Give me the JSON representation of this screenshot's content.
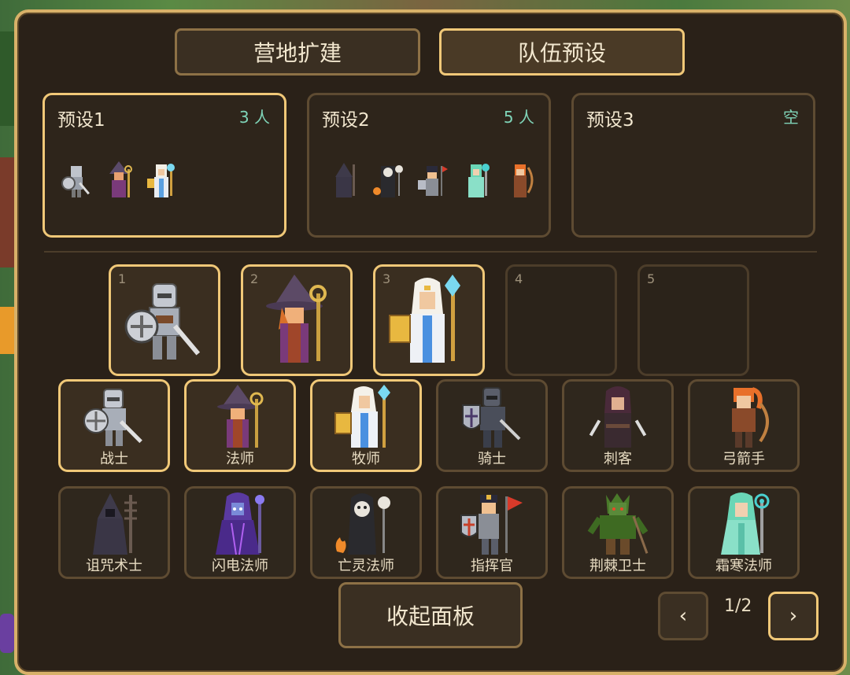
{
  "tabs": [
    {
      "label": "营地扩建",
      "active": false
    },
    {
      "label": "队伍预设",
      "active": true
    }
  ],
  "presets": [
    {
      "name": "预设1",
      "count": "3 人",
      "active": true
    },
    {
      "name": "预设2",
      "count": "5 人",
      "active": false
    },
    {
      "name": "预设3",
      "count": "空",
      "active": false
    }
  ],
  "slots": [
    {
      "number": "1",
      "unit": "warrior"
    },
    {
      "number": "2",
      "unit": "mage"
    },
    {
      "number": "3",
      "unit": "priest"
    },
    {
      "number": "4",
      "unit": ""
    },
    {
      "number": "5",
      "unit": ""
    }
  ],
  "roster": [
    {
      "label": "战士",
      "unit": "warrior",
      "selected": true
    },
    {
      "label": "法师",
      "unit": "mage",
      "selected": true
    },
    {
      "label": "牧师",
      "unit": "priest",
      "selected": true
    },
    {
      "label": "骑士",
      "unit": "knight",
      "selected": false
    },
    {
      "label": "刺客",
      "unit": "assassin",
      "selected": false
    },
    {
      "label": "弓箭手",
      "unit": "archer",
      "selected": false
    },
    {
      "label": "诅咒术士",
      "unit": "warlock",
      "selected": false
    },
    {
      "label": "闪电法师",
      "unit": "lightning-mage",
      "selected": false
    },
    {
      "label": "亡灵法师",
      "unit": "necromancer",
      "selected": false
    },
    {
      "label": "指挥官",
      "unit": "commander",
      "selected": false
    },
    {
      "label": "荆棘卫士",
      "unit": "thorn-guard",
      "selected": false
    },
    {
      "label": "霜寒法师",
      "unit": "frost-mage",
      "selected": false
    }
  ],
  "collapse_button": "收起面板",
  "pagination": {
    "prev": "‹",
    "next": "›",
    "current": "1/2"
  },
  "colors": {
    "accent": "#f0c878",
    "panel": "#2a2118",
    "count": "#7fd4b8"
  }
}
